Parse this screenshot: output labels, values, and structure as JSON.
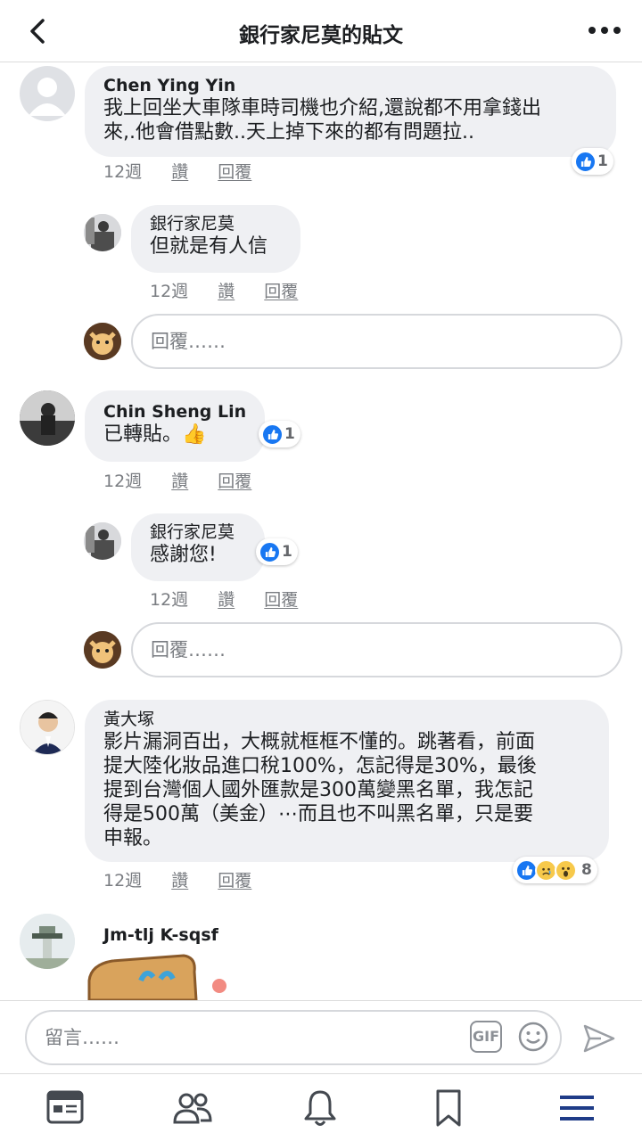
{
  "header": {
    "title": "銀行家尼莫的貼文"
  },
  "colors": {
    "like": "#1877f2",
    "bubble": "#eff0f3",
    "meta": "#7a7d82",
    "active_tab": "#1f3c88"
  },
  "comments": [
    {
      "name": "Chen  Ying Yin",
      "lines": [
        "我上回坐大車隊車時司機也介紹,還說都不用拿錢出",
        "來,.他會借點數..天上掉下來的都有問題拉.."
      ],
      "time": "12週",
      "like": "讚",
      "reply": "回覆",
      "reactions": "1",
      "replies": [
        {
          "name": "銀行家尼莫",
          "lines": [
            "但就是有人信"
          ],
          "time": "12週",
          "like": "讚",
          "reply": "回覆"
        }
      ],
      "reply_placeholder": "回覆……"
    },
    {
      "name": "Chin Sheng Lin",
      "lines": [
        "已轉貼。👍"
      ],
      "time": "12週",
      "like": "讚",
      "reply": "回覆",
      "reactions": "1",
      "replies": [
        {
          "name": "銀行家尼莫",
          "lines": [
            "感謝您!"
          ],
          "time": "12週",
          "like": "讚",
          "reply": "回覆",
          "reactions": "1"
        }
      ],
      "reply_placeholder": "回覆……"
    },
    {
      "name": "黃大塚",
      "lines": [
        "影片漏洞百出，大概就框框不懂的。跳著看，前面",
        "提大陸化妝品進口稅100%，怎記得是30%，最後",
        "提到台灣個人國外匯款是300萬變黑名單，我怎記",
        "得是500萬（美金）⋯而且也不叫黑名單，只是要",
        "申報。"
      ],
      "time": "12週",
      "like": "讚",
      "reply": "回覆",
      "reactions": "8"
    },
    {
      "name": "Jm-tlj  K-sqsf"
    }
  ],
  "composer": {
    "placeholder": "留言……",
    "gif": "GIF"
  },
  "icons": [
    "back-icon",
    "more-icon",
    "like-icon",
    "sad-icon",
    "wow-icon",
    "emoji-icon",
    "send-icon",
    "news-feed-icon",
    "friends-icon",
    "notifications-icon",
    "bookmark-icon",
    "menu-icon"
  ]
}
